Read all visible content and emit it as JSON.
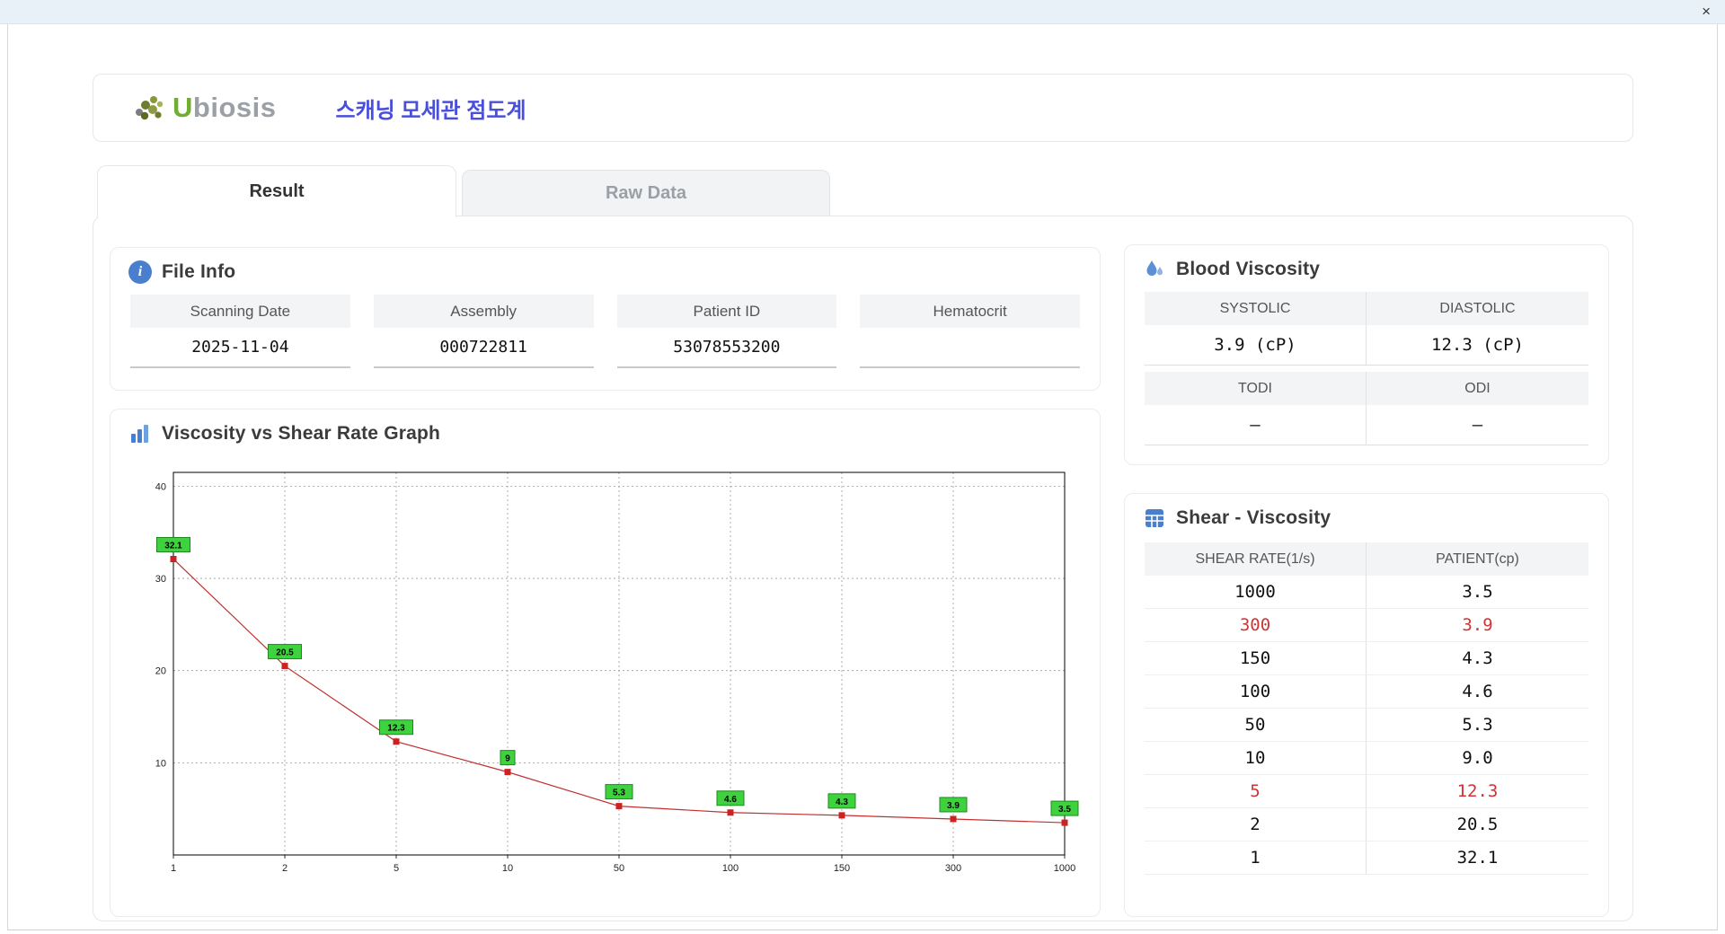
{
  "window": {
    "close_label": "×"
  },
  "header": {
    "logo_u": "U",
    "logo_rest": "biosis",
    "title": "스캐닝 모세관 점도계"
  },
  "tabs": {
    "result": "Result",
    "raw_data": "Raw Data"
  },
  "file_info": {
    "title": "File Info",
    "fields": [
      {
        "label": "Scanning Date",
        "value": "2025-11-04"
      },
      {
        "label": "Assembly",
        "value": "000722811"
      },
      {
        "label": "Patient ID",
        "value": "53078553200"
      },
      {
        "label": "Hematocrit",
        "value": ""
      }
    ]
  },
  "blood_viscosity": {
    "title": "Blood Viscosity",
    "systolic_label": "SYSTOLIC",
    "diastolic_label": "DIASTOLIC",
    "systolic_value": "3.9 (cP)",
    "diastolic_value": "12.3 (cP)",
    "todi_label": "TODI",
    "odi_label": "ODI",
    "todi_value": "–",
    "odi_value": "–"
  },
  "graph": {
    "title": "Viscosity vs Shear Rate Graph"
  },
  "shear_viscosity": {
    "title": "Shear - Viscosity",
    "columns": [
      "SHEAR RATE(1/s)",
      "PATIENT(cp)"
    ],
    "rows": [
      {
        "shear": "1000",
        "patient": "3.5",
        "highlight": false
      },
      {
        "shear": "300",
        "patient": "3.9",
        "highlight": true
      },
      {
        "shear": "150",
        "patient": "4.3",
        "highlight": false
      },
      {
        "shear": "100",
        "patient": "4.6",
        "highlight": false
      },
      {
        "shear": "50",
        "patient": "5.3",
        "highlight": false
      },
      {
        "shear": "10",
        "patient": "9.0",
        "highlight": false
      },
      {
        "shear": "5",
        "patient": "12.3",
        "highlight": true
      },
      {
        "shear": "2",
        "patient": "20.5",
        "highlight": false
      },
      {
        "shear": "1",
        "patient": "32.1",
        "highlight": false
      }
    ]
  },
  "chart_data": {
    "type": "line",
    "title": "Viscosity vs Shear Rate Graph",
    "x_axis_type": "category",
    "x_categories": [
      "1",
      "2",
      "5",
      "10",
      "50",
      "100",
      "150",
      "300",
      "1000"
    ],
    "series": [
      {
        "name": "patient-viscosity",
        "values": [
          32.1,
          20.5,
          12.3,
          9,
          5.3,
          4.6,
          4.3,
          3.9,
          3.5
        ]
      }
    ],
    "point_labels": [
      "32.1",
      "20.5",
      "12.3",
      "9",
      "5.3",
      "4.6",
      "4.3",
      "3.9",
      "3.5"
    ],
    "yticks": [
      10,
      20,
      30,
      40
    ],
    "ylim": [
      0,
      41.5
    ],
    "grid": "dashed",
    "legend": "none",
    "xlabel": "",
    "ylabel": "",
    "line_color": "#c03030",
    "marker_color": "#cc2222",
    "label_fill": "#3fd23f",
    "label_stroke": "#1e8a1e"
  }
}
